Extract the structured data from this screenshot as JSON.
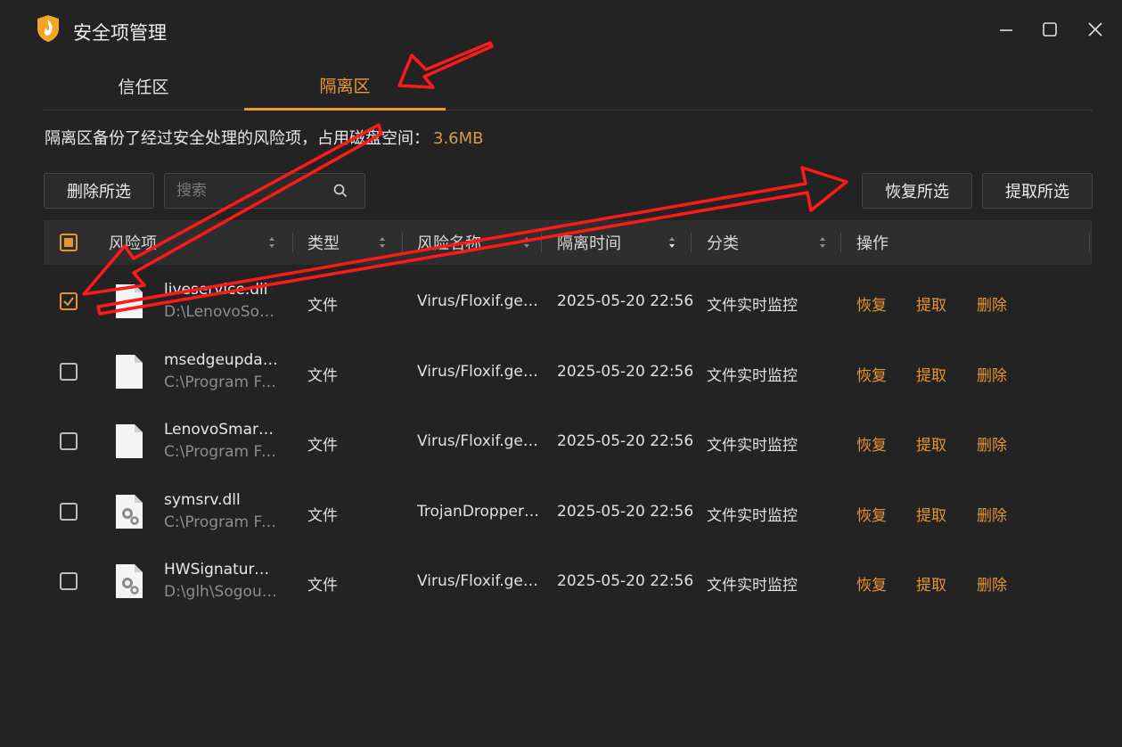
{
  "window": {
    "title": "安全项管理"
  },
  "tabs": [
    {
      "label": "信任区",
      "active": false
    },
    {
      "label": "隔离区",
      "active": true
    }
  ],
  "info": {
    "text": "隔离区备份了经过安全处理的风险项，占用磁盘空间：",
    "size": "3.6MB"
  },
  "toolbar": {
    "delete_label": "删除所选",
    "search_placeholder": "搜索",
    "restore_label": "恢复所选",
    "extract_label": "提取所选"
  },
  "table": {
    "columns": [
      "风险项",
      "类型",
      "风险名称",
      "隔离时间",
      "分类",
      "操作"
    ],
    "actions": {
      "restore": "恢复",
      "extract": "提取",
      "delete": "删除"
    },
    "rows": [
      {
        "name": "liveservice.dll",
        "path": "D:\\LenovoSoft...",
        "type": "文件",
        "risk": "Virus/Floxif.gen...",
        "time": "2025-05-20 22:56",
        "category": "文件实时监控",
        "checked": true,
        "icon": "blank-file-icon"
      },
      {
        "name": "msedgeupdat...",
        "path": "C:\\Program Fil...",
        "type": "文件",
        "risk": "Virus/Floxif.gen...",
        "time": "2025-05-20 22:56",
        "category": "文件实时监控",
        "checked": false,
        "icon": "blank-file-icon"
      },
      {
        "name": "LenovoSmartS...",
        "path": "C:\\Program Fil...",
        "type": "文件",
        "risk": "Virus/Floxif.gen...",
        "time": "2025-05-20 22:56",
        "category": "文件实时监控",
        "checked": false,
        "icon": "blank-file-icon"
      },
      {
        "name": "symsrv.dll",
        "path": "C:\\Program Fil...",
        "type": "文件",
        "risk": "TrojanDropper/...",
        "time": "2025-05-20 22:56",
        "category": "文件实时监控",
        "checked": false,
        "icon": "settings-file-icon"
      },
      {
        "name": "HWSignature....",
        "path": "D:\\glh\\Sogoul...",
        "type": "文件",
        "risk": "Virus/Floxif.gen...",
        "time": "2025-05-20 22:56",
        "category": "文件实时监控",
        "checked": false,
        "icon": "settings-file-icon"
      }
    ]
  },
  "colors": {
    "accent": "#e8952e",
    "background": "#232323",
    "annotation": "#ff1a1a"
  }
}
